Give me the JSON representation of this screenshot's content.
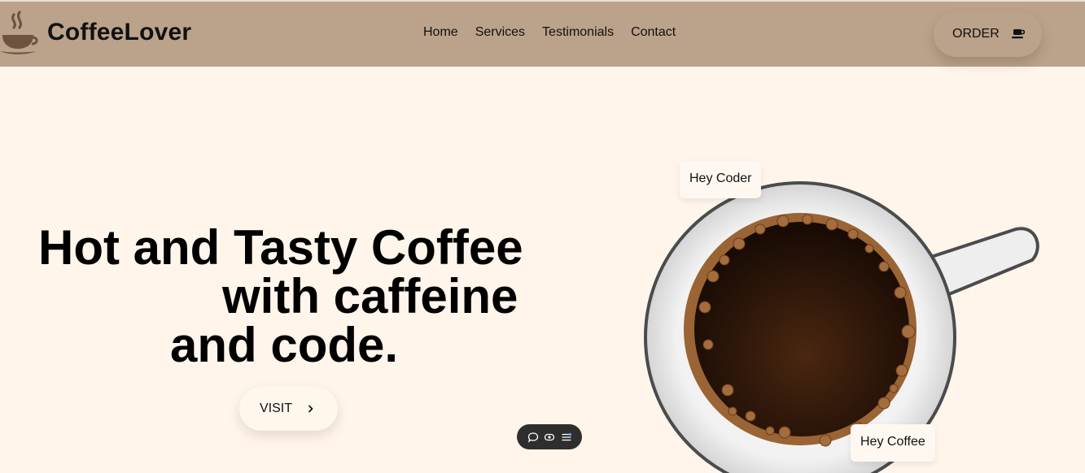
{
  "brand": {
    "name": "CoffeeLover",
    "logo_icon": "coffee-cup-steam-icon"
  },
  "nav": {
    "links": [
      "Home",
      "Services",
      "Testimonials",
      "Contact"
    ]
  },
  "order_button": {
    "label": "ORDER",
    "icon": "coffee-mug-icon"
  },
  "hero": {
    "title_lines": [
      "Hot and Tasty Coffee",
      "with caffeine",
      "and code."
    ],
    "visit_button": {
      "label": "VISIT",
      "icon": "chevron-right-icon"
    }
  },
  "bubbles": {
    "top": "Hey Coder",
    "bottom": "Hey Coffee"
  },
  "dev_toolbar": {
    "icons": [
      "comment-icon",
      "eye-icon",
      "settings-list-icon"
    ]
  },
  "colors": {
    "navbar": "#bba28a",
    "page_background": "#fff5eb",
    "coffee_dark": "#1e0f06",
    "coffee_foam": "#9a6434",
    "toolbar": "#2e2e2e"
  }
}
